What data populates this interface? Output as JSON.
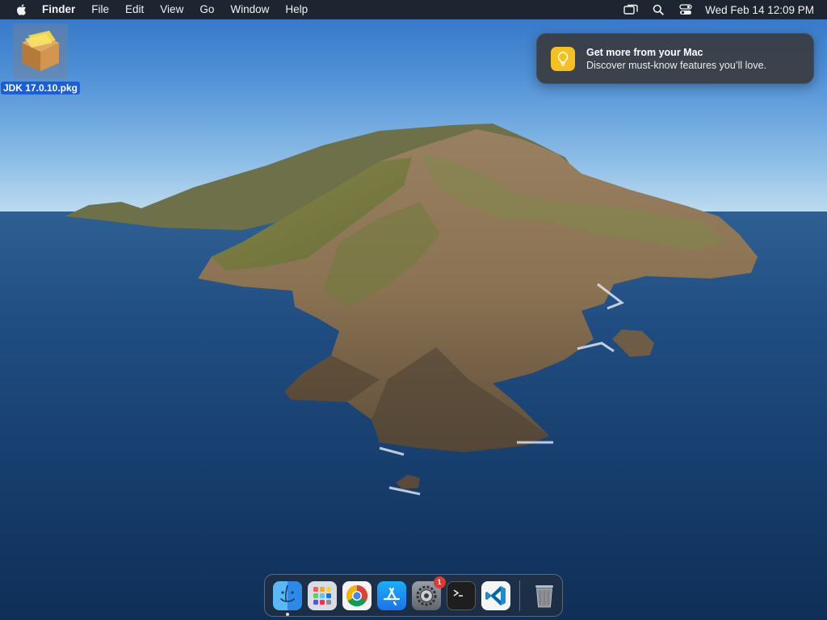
{
  "menubar": {
    "app_name": "Finder",
    "menus": [
      "File",
      "Edit",
      "View",
      "Go",
      "Window",
      "Help"
    ],
    "clock": "Wed Feb 14  12:09 PM",
    "status_icons": [
      "screen-mirroring-icon",
      "spotlight-search-icon",
      "control-center-icon"
    ]
  },
  "desktop": {
    "icons": [
      {
        "label": "JDK 17.0.10.pkg",
        "icon": "package-icon",
        "selected": true
      }
    ]
  },
  "notification": {
    "title": "Get more from your Mac",
    "body": "Discover must-know features you’ll love.",
    "icon": "lightbulb-icon"
  },
  "dock": {
    "apps": [
      {
        "name": "Finder",
        "icon": "finder-icon",
        "running": true
      },
      {
        "name": "Launchpad",
        "icon": "launchpad-icon",
        "running": false
      },
      {
        "name": "Google Chrome",
        "icon": "chrome-icon",
        "running": false
      },
      {
        "name": "App Store",
        "icon": "app-store-icon",
        "running": false
      },
      {
        "name": "System Settings",
        "icon": "settings-icon",
        "running": false,
        "badge": "1"
      },
      {
        "name": "Terminal",
        "icon": "terminal-icon",
        "running": false
      },
      {
        "name": "Visual Studio Code",
        "icon": "vscode-icon",
        "running": false
      }
    ],
    "trash": {
      "name": "Trash",
      "icon": "trash-icon"
    }
  },
  "colors": {
    "menubar_bg": "#1c1e24",
    "selection": "#1c5dd8",
    "notification_bg": "#3a3c42",
    "badge": "#e5372f"
  }
}
